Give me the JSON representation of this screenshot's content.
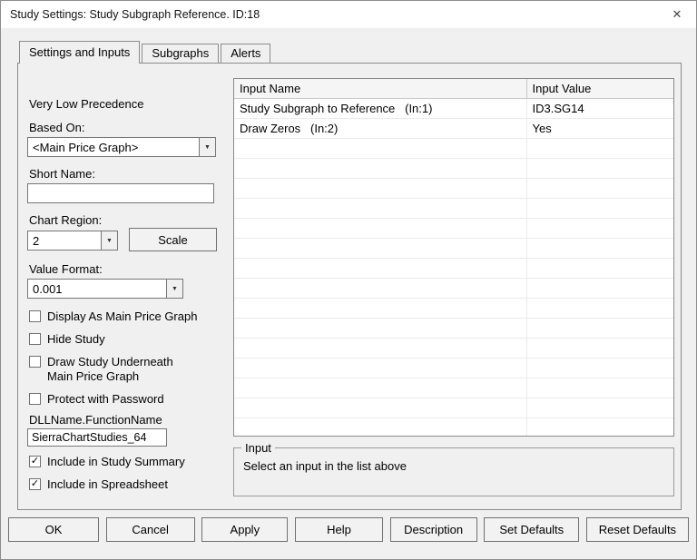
{
  "window": {
    "title": "Study Settings: Study Subgraph Reference. ID:18"
  },
  "icons": {
    "close": "✕",
    "dropdown_arrow": "▼",
    "checkmark": "✓"
  },
  "tabs": [
    {
      "label": "Settings and Inputs",
      "active": true
    },
    {
      "label": "Subgraphs",
      "active": false
    },
    {
      "label": "Alerts",
      "active": false
    }
  ],
  "left": {
    "precedence_label": "Very Low Precedence",
    "based_on_label": "Based On:",
    "based_on_value": "<Main Price Graph>",
    "short_name_label": "Short Name:",
    "short_name_value": "",
    "chart_region_label": "Chart Region:",
    "chart_region_value": "2",
    "scale_button": "Scale",
    "value_format_label": "Value Format:",
    "value_format_value": "0.001",
    "checkboxes": [
      {
        "label": "Display As Main Price Graph",
        "checked": false
      },
      {
        "label": "Hide Study",
        "checked": false
      },
      {
        "label": "Draw Study Underneath\nMain Price Graph",
        "checked": false
      },
      {
        "label": "Protect with Password",
        "checked": false
      }
    ],
    "dll_label": "DLLName.FunctionName",
    "dll_value": "SierraChartStudies_64",
    "summary_checkboxes": [
      {
        "label": "Include in Study Summary",
        "checked": true
      },
      {
        "label": "Include in Spreadsheet",
        "checked": true
      }
    ]
  },
  "inputs_table": {
    "headers": [
      "Input Name",
      "Input Value"
    ],
    "rows": [
      {
        "name": "Study Subgraph to Reference   (In:1)",
        "value": "ID3.SG14"
      },
      {
        "name": "Draw Zeros   (In:2)",
        "value": "Yes"
      }
    ],
    "empty_rows": 15
  },
  "input_group": {
    "title": "Input",
    "message": "Select an input in the list above"
  },
  "footer_buttons": [
    "OK",
    "Cancel",
    "Apply",
    "Help",
    "Description",
    "Set Defaults",
    "Reset Defaults"
  ]
}
